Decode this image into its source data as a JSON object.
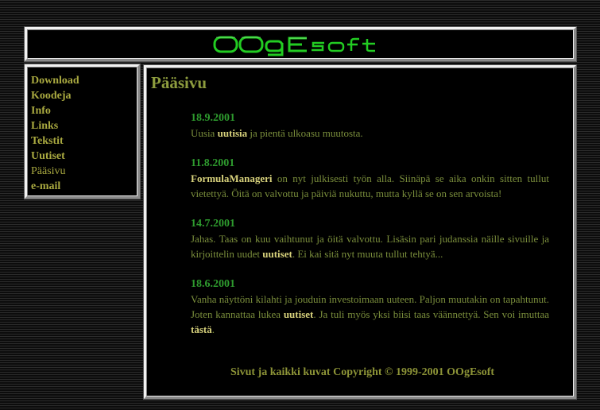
{
  "header": {
    "logo_text": "OOgEsoft",
    "logo_color": "#22cc22"
  },
  "nav": {
    "items": [
      {
        "label": "Download"
      },
      {
        "label": "Koodeja"
      },
      {
        "label": "Info"
      },
      {
        "label": "Links"
      },
      {
        "label": "Tekstit"
      },
      {
        "label": "Uutiset"
      },
      {
        "label": "Pääsivu",
        "current": true
      },
      {
        "label": "e-mail"
      }
    ]
  },
  "content": {
    "title": "Pääsivu",
    "news": [
      {
        "date": "18.9.2001",
        "parts": [
          "Uusia ",
          "uutisia",
          " ja pientä ulkoasu muutosta."
        ]
      },
      {
        "date": "11.8.2001",
        "parts": [
          "FormulaManageri",
          " on nyt julkisesti työn alla. Siinäpä se aika onkin sitten tullut vietettyä. Öitä on valvottu ja päiviä nukuttu, mutta kyllä se on sen arvoista!"
        ]
      },
      {
        "date": "14.7.2001",
        "parts": [
          "Jahas. Taas on kuu vaihtunut ja öitä valvottu. Lisäsin pari judanssia näille sivuille ja kirjoittelin uudet ",
          "uutiset",
          ". Ei kai sitä nyt muuta tullut tehtyä..."
        ]
      },
      {
        "date": "18.6.2001",
        "parts": [
          "Vanha näyttöni kilahti ja jouduin investoimaan uuteen. Paljon muutakin on tapahtunut. Joten kannattaa lukea ",
          "uutiset",
          ". Ja tuli myös yksi biisi taas väännettyä. Sen voi imuttaa ",
          "tästä",
          "."
        ]
      }
    ],
    "footer": "Sivut ja kaikki kuvat Copyright © 1999-2001 OOgEsoft"
  }
}
